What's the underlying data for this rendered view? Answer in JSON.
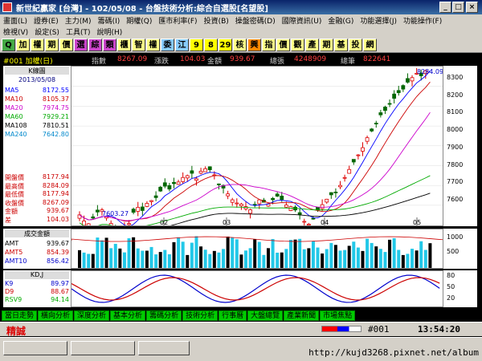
{
  "window": {
    "title": "新世紀贏家 [台灣] - 102/05/08 - 台盤技術分析:綜合自選股[名望股]"
  },
  "menu": {
    "row1": [
      "畫面(L)",
      "證券(E)",
      "主力(M)",
      "籌碼(I)",
      "期權(Q)",
      "匯市利率(F)",
      "投資(B)",
      "操盤密碼(D)",
      "國際資訊(U)",
      "金融(G)",
      "功能選擇(J)",
      "功能操作(F)"
    ],
    "row2": [
      "檢視(V)",
      "設定(S)",
      "工具(T)",
      "說明(H)"
    ]
  },
  "toolbar": [
    "Q",
    "加",
    "權",
    "期",
    "價",
    "選",
    "綜",
    "類",
    "櫃",
    "智",
    "權",
    "委",
    "江",
    "9",
    "8",
    "29",
    "核",
    "興",
    "指",
    "價",
    "觀",
    "產",
    "期",
    "基",
    "投",
    "網"
  ],
  "info": {
    "code": "#001 加權(日)",
    "index_label": "指數",
    "index_value": "8267.09",
    "change_label": "漲跌",
    "change_value": "104.03",
    "amount_label": "金額",
    "amount_value": "939.67",
    "volume_label": "總張",
    "volume_value": "4248909",
    "trades_label": "總筆",
    "trades_value": "822641"
  },
  "left": {
    "header": "K線圖",
    "date": "2013/05/08",
    "ma": [
      {
        "label": "MA5",
        "value": "8172.55",
        "color": "#0000ff"
      },
      {
        "label": "MA10",
        "value": "8105.37",
        "color": "#cc0000"
      },
      {
        "label": "MA20",
        "value": "7974.75",
        "color": "#cc00cc"
      },
      {
        "label": "MA60",
        "value": "7929.21",
        "color": "#00aa00"
      },
      {
        "label": "MA108",
        "value": "7810.51",
        "color": "#000000"
      },
      {
        "label": "MA240",
        "value": "7642.80",
        "color": "#0088cc"
      }
    ],
    "ohlc": [
      {
        "label": "開盤價",
        "value": "8177.94"
      },
      {
        "label": "最高價",
        "value": "8284.09"
      },
      {
        "label": "最低價",
        "value": "8177.94"
      },
      {
        "label": "收盤價",
        "value": "8267.09"
      },
      {
        "label": "金額",
        "value": "939.67"
      },
      {
        "label": "差",
        "value": "104.03"
      }
    ]
  },
  "chart": {
    "high_label": "8284.09",
    "low_label": "7603.27",
    "yticks": [
      "8300",
      "8200",
      "8100",
      "8000",
      "7900",
      "7800",
      "7700",
      "7600"
    ],
    "xticks": [
      "02",
      "03",
      "04",
      "05"
    ]
  },
  "volume": {
    "header": "成交金額",
    "rows": [
      {
        "label": "AMT",
        "value": "939.67"
      },
      {
        "label": "AMT5",
        "value": "854.39"
      },
      {
        "label": "AMT10",
        "value": "856.42"
      }
    ],
    "yticks": [
      "1000",
      "500"
    ]
  },
  "kd": {
    "header": "KD,J",
    "rows": [
      {
        "label": "K9",
        "value": "89.97"
      },
      {
        "label": "D9",
        "value": "88.67"
      },
      {
        "label": "RSV9",
        "value": "94.14"
      }
    ],
    "yticks": [
      "80",
      "50",
      "20"
    ]
  },
  "tabs": [
    "當日走勢",
    "橫向分析",
    "深度分析",
    "基本分析",
    "籌碼分析",
    "技術分析",
    "行事曆",
    "大盤總覽",
    "產業新聞",
    "市場焦點"
  ],
  "status": {
    "label": "精誠",
    "code": "#001",
    "time": "13:54:20"
  },
  "watermark": "http://kujd3268.pixnet.net/album"
}
